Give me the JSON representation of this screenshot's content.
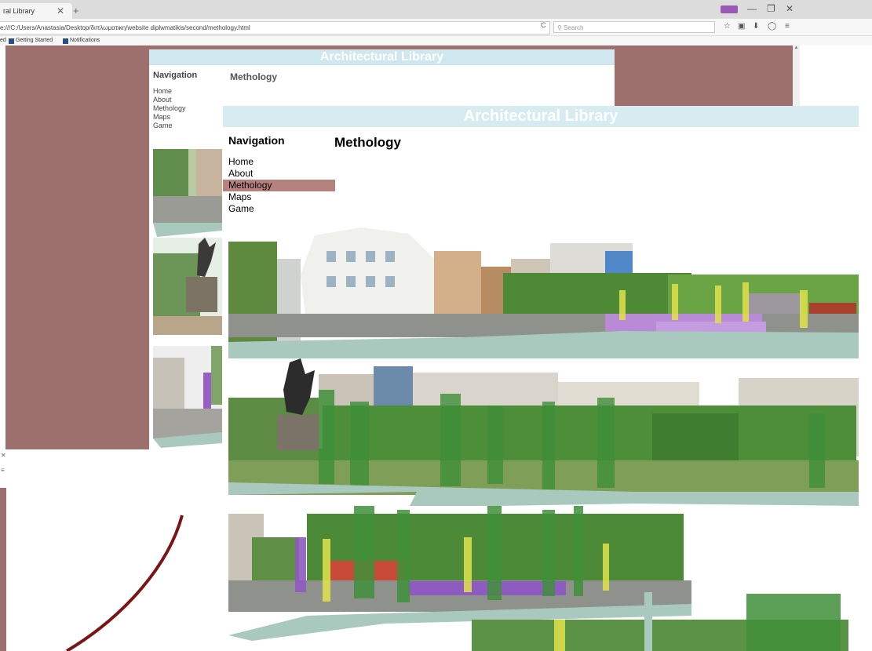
{
  "browser": {
    "tab_title": "ral Library",
    "tab_close": "✕",
    "new_tab": "+",
    "window_controls": [
      "—",
      "❐",
      "✕"
    ],
    "url": "e:///C:/Users/Anastasia/Desktop/διπλωματικη/website diplwmatikis/second/methology.html",
    "reload_icon": "C",
    "search_placeholder": "Search",
    "nav_icons": [
      "☆",
      "▣",
      "⬇",
      "◯",
      "≡"
    ],
    "bookmarks": [
      "ed",
      "Getting Started",
      "Notifications"
    ],
    "scroll_up_icon": "▲"
  },
  "back_page": {
    "header": "Architectural Library",
    "nav_title": "Navigation",
    "nav_items": [
      "Home",
      "About",
      "Methology",
      "Maps",
      "Game"
    ],
    "page_title": "Methology"
  },
  "left_remnant": {
    "close_icon": "✕",
    "menu_icon": "≡"
  },
  "front_page": {
    "header": "Architectural Library",
    "nav_title": "Navigation",
    "nav_items": [
      "Home",
      "About",
      "Methology",
      "Maps",
      "Game"
    ],
    "active_item": "Methology",
    "page_title": "Methology"
  },
  "colors": {
    "mauve": "#9e706d",
    "active_nav": "#b5827f",
    "header_blue": "#d6ecf1",
    "ground_teal": "#a9c9bf",
    "purple_marker": "#8e5bc1",
    "yellow_marker": "#e0e24a",
    "green_marker": "#3f8f3a"
  }
}
